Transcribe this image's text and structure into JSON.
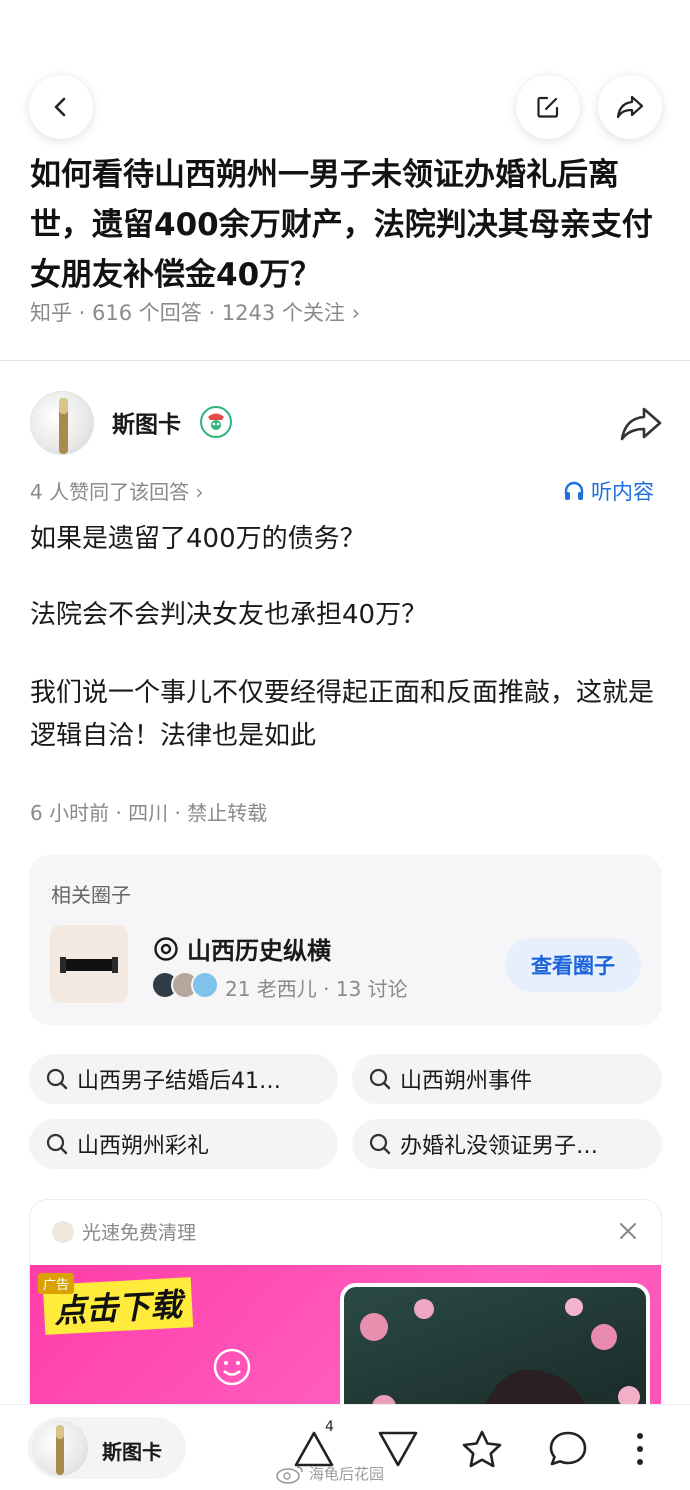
{
  "question": {
    "title": "如何看待山西朔州一男子未领证办婚礼后离世，遗留400余万财产，法院判决其母亲支付女朋友补偿金40万？",
    "meta": "知乎 · 616 个回答 · 1243 个关注 ›"
  },
  "answer": {
    "author_name": "斯图卡",
    "agree_text": "4 人赞同了该回答 ›",
    "listen_label": "听内容",
    "paragraphs": [
      "如果是遗留了400万的债务？",
      "法院会不会判决女友也承担40万？",
      "我们说一个事儿不仅要经得起正面和反面推敲，这就是逻辑自洽！法律也是如此"
    ],
    "post_meta": "6 小时前 · 四川 · 禁止转载"
  },
  "circle": {
    "section_label": "相关圈子",
    "name": "山西历史纵横",
    "stats": "21 老西儿 · 13 讨论",
    "button_label": "查看圈子"
  },
  "search_chips": [
    "山西男子结婚后41…",
    "山西朔州事件",
    "山西朔州彩礼",
    "办婚礼没领证男子…"
  ],
  "ad": {
    "source": "光速免费清理",
    "tag": "广告",
    "headline": "点击下载"
  },
  "bottom_bar": {
    "author_name": "斯图卡",
    "upvote_count": "4"
  },
  "watermark": "海龟后花园",
  "colors": {
    "accent_blue": "#1f6fe0",
    "circle_button_bg": "#e7effd",
    "ad_pink": "#ff4fb5",
    "ad_yellow": "#ffeb3b"
  },
  "icons": [
    "back-arrow-icon",
    "edit-icon",
    "share-icon",
    "headphones-icon",
    "circle-icon",
    "search-icon",
    "close-icon",
    "upvote-icon",
    "downvote-icon",
    "star-icon",
    "comment-icon",
    "more-icon"
  ]
}
